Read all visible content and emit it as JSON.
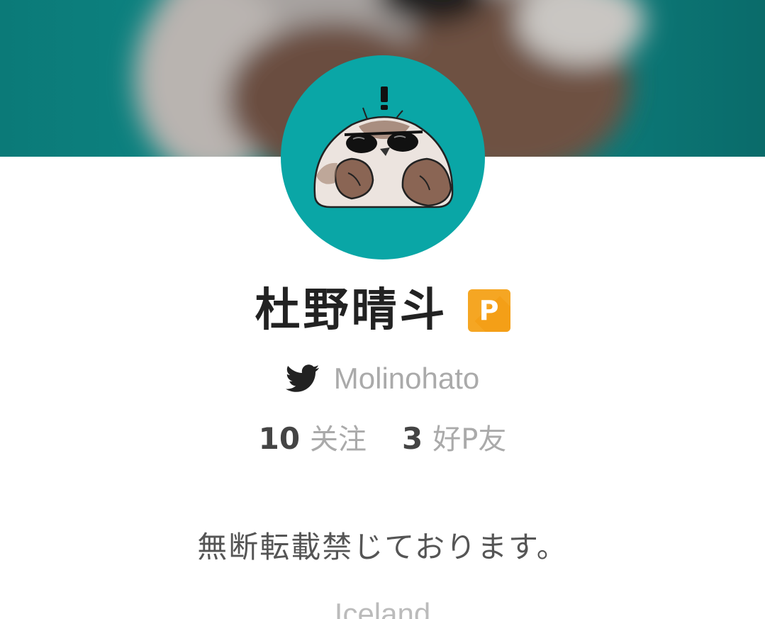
{
  "profile": {
    "name": "杜野晴斗",
    "premium_badge": "P",
    "twitter_handle": "Molinohato",
    "bio": "無断転載禁じております。",
    "location": "Iceland"
  },
  "stats": {
    "following_count": "10",
    "following_label": "关注",
    "friends_count": "3",
    "friends_label": "好P友"
  },
  "icons": {
    "twitter": "twitter-bird-icon",
    "badge": "premium-badge-icon"
  },
  "colors": {
    "cover_bg": "#0a6f6e",
    "avatar_bg": "#0aa6a6",
    "badge": "#f5a623",
    "name": "#222222",
    "muted": "#aaaaaa"
  }
}
